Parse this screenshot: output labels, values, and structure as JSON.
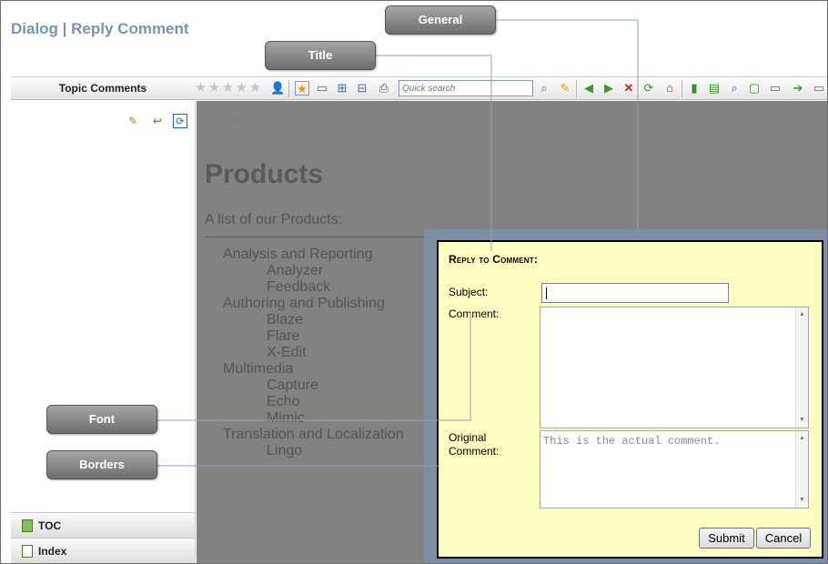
{
  "page": {
    "title": "Dialog | Reply Comment"
  },
  "callouts": {
    "general": "General",
    "title": "Title",
    "font": "Font",
    "borders": "Borders"
  },
  "toolbar": {
    "nav_tab": "Topic Comments",
    "rating_stars": 5,
    "search_placeholder": "Quick search"
  },
  "sidebar": {
    "accordion": [
      {
        "label": "TOC"
      },
      {
        "label": "Index"
      }
    ]
  },
  "topic": {
    "heading": "Products",
    "intro": "A list of our Products:",
    "items": [
      {
        "text": "Analysis and Reporting",
        "level": 1
      },
      {
        "text": "Analyzer",
        "level": 2
      },
      {
        "text": "Feedback",
        "level": 2
      },
      {
        "text": "Authoring and Publishing",
        "level": 1
      },
      {
        "text": "Blaze",
        "level": 2
      },
      {
        "text": "Flare",
        "level": 2
      },
      {
        "text": "X-Edit",
        "level": 2
      },
      {
        "text": "Multimedia",
        "level": 1
      },
      {
        "text": "Capture",
        "level": 2
      },
      {
        "text": "Echo",
        "level": 2
      },
      {
        "text": "Mimic",
        "level": 2
      },
      {
        "text": "Translation and Localization",
        "level": 1
      },
      {
        "text": "Lingo",
        "level": 2
      }
    ]
  },
  "dialog": {
    "title": "Reply to Comment:",
    "subject_label": "Subject:",
    "subject_value": "",
    "comment_label": "Comment:",
    "comment_value": "",
    "original_label_line1": "Original",
    "original_label_line2": "Comment:",
    "original_value": "This is the actual comment.",
    "submit_label": "Submit",
    "cancel_label": "Cancel"
  },
  "colors": {
    "title_blue": "#7a94ad",
    "dialog_bg": "#ffffc4",
    "dialog_border_shadow": "#7d8ea3",
    "overlay": "#808080"
  }
}
